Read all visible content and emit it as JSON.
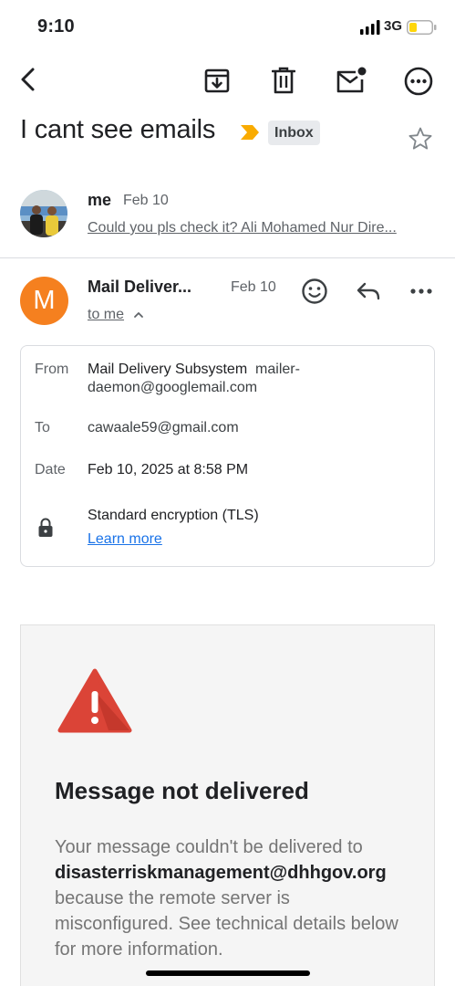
{
  "status_bar": {
    "time": "9:10",
    "network": "3G"
  },
  "toolbar": {
    "back_icon": "back-arrow-icon",
    "archive_icon": "archive-icon",
    "delete_icon": "trash-icon",
    "mark_unread_icon": "mail-unread-icon",
    "more_icon": "more-circle-icon"
  },
  "thread": {
    "subject": "I cant see emails",
    "label": "Inbox",
    "label_arrow_color": "#f9ab00"
  },
  "message_collapsed": {
    "sender": "me",
    "date": "Feb 10",
    "snippet": "Could you pls check it? Ali Mohamed Nur Dire..."
  },
  "message_expanded": {
    "avatar_letter": "M",
    "avatar_color": "#f5801f",
    "sender": "Mail Deliver...",
    "date": "Feb 10",
    "recipient": "to me"
  },
  "details": {
    "from_label": "From",
    "from_name": "Mail Delivery Subsystem",
    "from_email": "mailer-daemon@googlemail.com",
    "to_label": "To",
    "to_value": "cawaale59@gmail.com",
    "date_label": "Date",
    "date_value": "Feb 10, 2025 at 8:58 PM",
    "encryption": "Standard encryption (TLS)",
    "learn_more": "Learn more"
  },
  "bounce": {
    "title": "Message not delivered",
    "body_prefix": "Your message couldn't be delivered to ",
    "address": "disasterriskmanagement@dhhgov.org",
    "body_suffix": " because the remote server is misconfigured. See technical details below for more information."
  }
}
